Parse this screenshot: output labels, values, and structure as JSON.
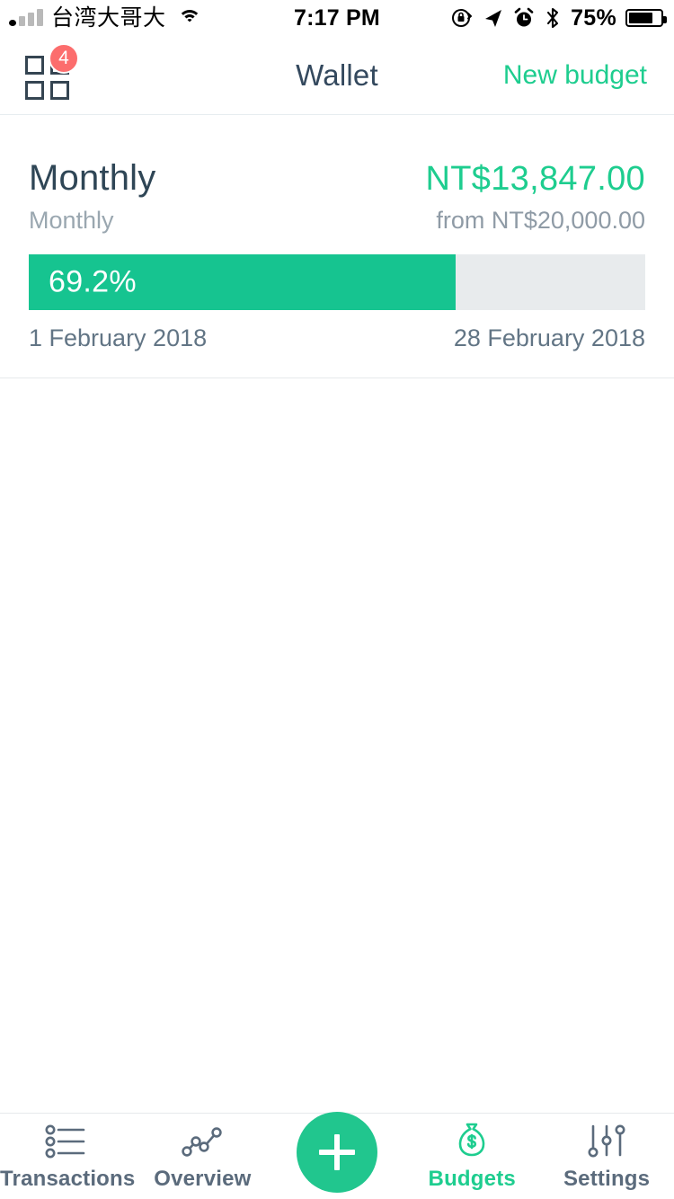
{
  "status_bar": {
    "carrier": "台湾大哥大",
    "time": "7:17 PM",
    "battery_percent": "75%",
    "icons": [
      "signal-bars-icon",
      "wifi-icon",
      "rotation-lock-icon",
      "location-arrow-icon",
      "alarm-clock-icon",
      "bluetooth-icon",
      "battery-icon"
    ]
  },
  "header": {
    "menu_badge": "4",
    "title": "Wallet",
    "action_label": "New budget"
  },
  "budget": {
    "name": "Monthly",
    "period": "Monthly",
    "spent_amount": "NT$13,847.00",
    "total_amount": "from NT$20,000.00",
    "progress_label": "69.2%",
    "progress_percent": 69.2,
    "start_date": "1 February 2018",
    "end_date": "28 February 2018"
  },
  "tabs": [
    {
      "label": "Transactions",
      "icon": "list-icon",
      "active": false
    },
    {
      "label": "Overview",
      "icon": "line-chart-icon",
      "active": false
    },
    {
      "label": "",
      "icon": "plus-icon",
      "active": false
    },
    {
      "label": "Budgets",
      "icon": "money-bag-icon",
      "active": true
    },
    {
      "label": "Settings",
      "icon": "sliders-icon",
      "active": false
    }
  ],
  "colors": {
    "accent_green": "#1ecd8f",
    "bar_fill": "#16c490",
    "bar_track": "#e8ebed",
    "badge_red": "#fc6d6d",
    "text_dark": "#2f4656",
    "text_muted": "#9aa7b0"
  }
}
